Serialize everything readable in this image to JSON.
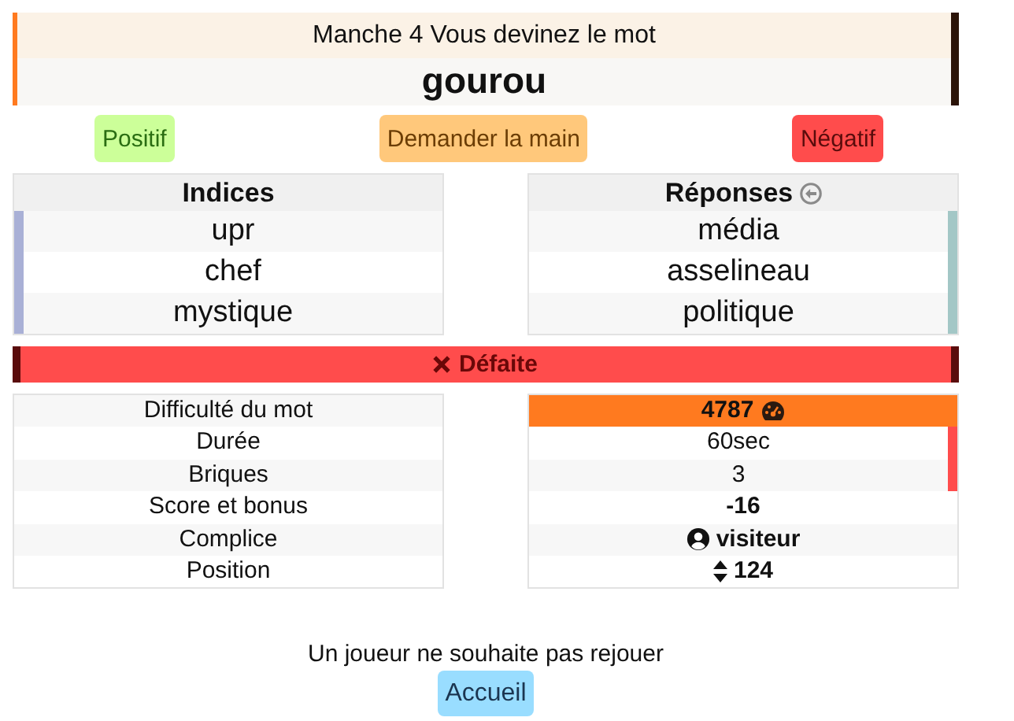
{
  "round": {
    "title": "Manche 4 Vous devinez le mot",
    "word": "gourou"
  },
  "actions": [
    {
      "label": "Positif",
      "kind": "positive"
    },
    {
      "label": "Demander la main",
      "kind": "hand"
    },
    {
      "label": "Négatif",
      "kind": "negative"
    }
  ],
  "clues": {
    "title": "Indices",
    "color": "#a9b0d6",
    "items": [
      "upr",
      "chef",
      "mystique"
    ]
  },
  "answers": {
    "title": "Réponses",
    "color": "#a3c7c6",
    "items": [
      "média",
      "asselineau",
      "politique"
    ]
  },
  "result": {
    "label": "Défaite",
    "kind": "defeat"
  },
  "stats": [
    {
      "label": "Difficulté du mot",
      "value": "4787",
      "kind": "difficulty",
      "flagged": false
    },
    {
      "label": "Durée",
      "value": "60sec",
      "kind": "plain",
      "flagged": true
    },
    {
      "label": "Briques",
      "value": "3",
      "kind": "plain",
      "flagged": true
    },
    {
      "label": "Score et bonus",
      "value": "-16",
      "kind": "bold",
      "flagged": false
    },
    {
      "label": "Complice",
      "value": "visiteur",
      "kind": "player",
      "flagged": false
    },
    {
      "label": "Position",
      "value": "124",
      "kind": "position",
      "flagged": false
    }
  ],
  "message": "Un joueur ne souhaite pas rejouer",
  "home_button": "Accueil"
}
